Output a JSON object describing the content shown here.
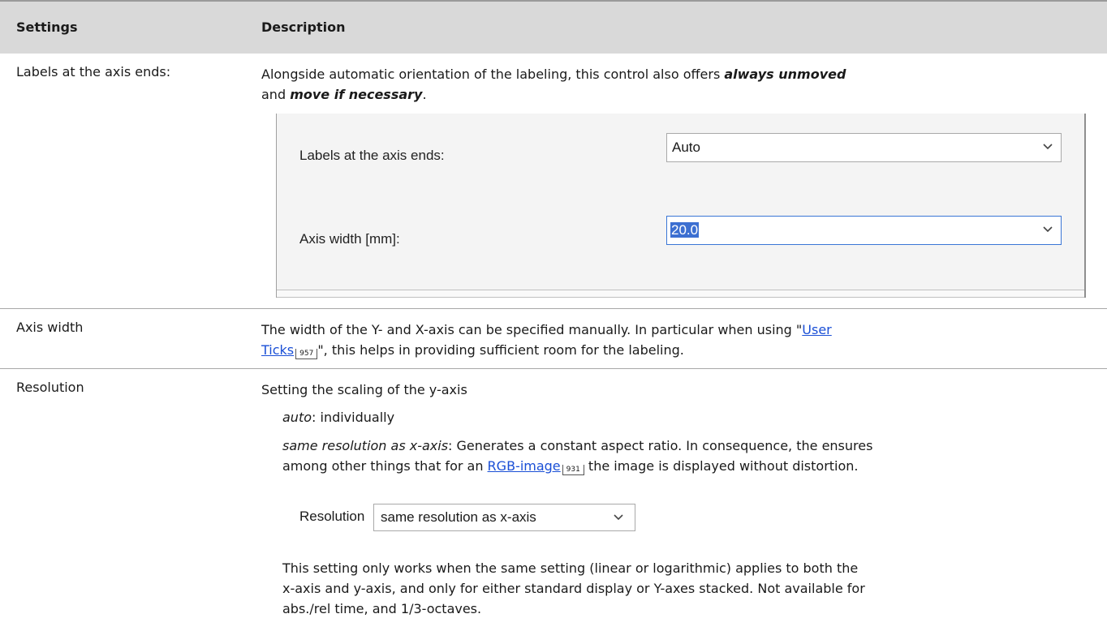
{
  "header": {
    "col1": "Settings",
    "col2": "Description"
  },
  "rows": {
    "labels": {
      "label": "Labels at the axis ends:",
      "desc_pre": "Alongside automatic orientation of the labeling, this control also offers ",
      "desc_em1": "always unmoved",
      "desc_and": "and ",
      "desc_em2": "move if necessary",
      "desc_end": ".",
      "dialog": {
        "labels_label": "Labels at the axis ends:",
        "labels_value": "Auto",
        "axis_label": "Axis width [mm]:",
        "axis_value": "20.0"
      }
    },
    "axis": {
      "label": "Axis width",
      "desc_pre": "The width of the Y- and X-axis can be specified manually. In particular when using \"",
      "link1": "User",
      "link2": "Ticks",
      "ref": "957",
      "desc_post": "\", this helps in providing sufficient room for the labeling."
    },
    "resolution": {
      "label": "Resolution",
      "line1": "Setting the scaling of the y-axis",
      "auto_em": "auto",
      "auto_rest": ": individually",
      "same_em": "same resolution as x-axis",
      "same_rest": ": Generates a constant aspect ratio. In consequence, the ensures",
      "among_pre": "among other things that for an ",
      "rgb_link": "RGB-image",
      "rgb_ref": "931",
      "among_post": " the image is displayed without distortion.",
      "combo_label": "Resolution",
      "combo_value": "same resolution as x-axis",
      "note1": "This setting only works when the same setting (linear or logarithmic) applies to both the",
      "note2": "x-axis and y-axis, and only for either standard display or Y-axes stacked. Not available for",
      "note3": "abs./rel time, and 1/3-octaves."
    }
  }
}
